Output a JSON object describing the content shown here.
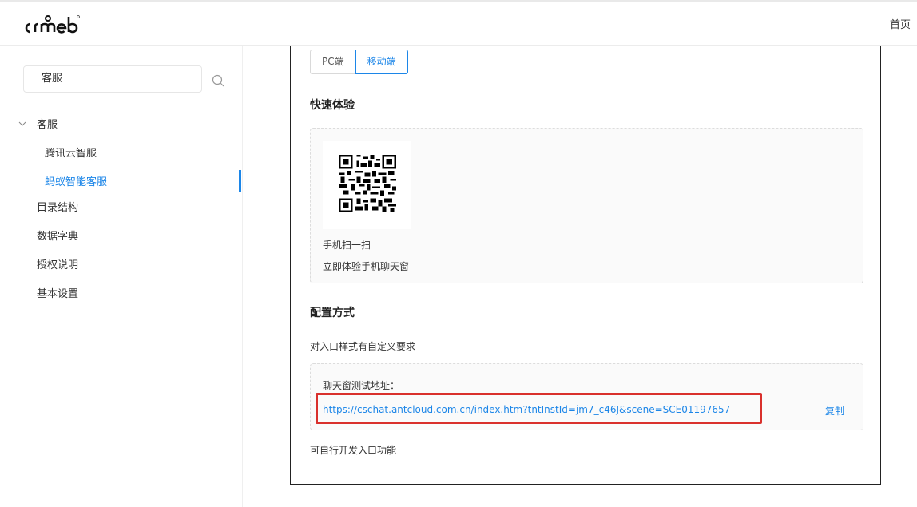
{
  "header": {
    "logo_text": "crmeb",
    "home_label": "首页"
  },
  "sidebar": {
    "search_value": "客服",
    "group_label": "客服",
    "sub_items": [
      {
        "label": "腾讯云智服"
      },
      {
        "label": "蚂蚁智能客服"
      }
    ],
    "items": [
      {
        "label": "目录结构"
      },
      {
        "label": "数据字典"
      },
      {
        "label": "授权说明"
      },
      {
        "label": "基本设置"
      }
    ]
  },
  "main": {
    "tabs": [
      {
        "label": "PC端"
      },
      {
        "label": "移动端"
      }
    ],
    "quick_title": "快速体验",
    "qr_caption_1": "手机扫一扫",
    "qr_caption_2": "立即体验手机聊天窗",
    "config_title": "配置方式",
    "custom_text": "对入口样式有自定义要求",
    "test_url_label": "聊天窗测试地址：",
    "test_url": "https://cschat.antcloud.com.cn/index.htm?tntInstId=jm7_c46J&scene=SCE01197657",
    "copy_label": "复制",
    "dev_text": "可自行开发入口功能"
  },
  "colors": {
    "accent": "#1c86e8",
    "highlight": "#d9302c"
  }
}
